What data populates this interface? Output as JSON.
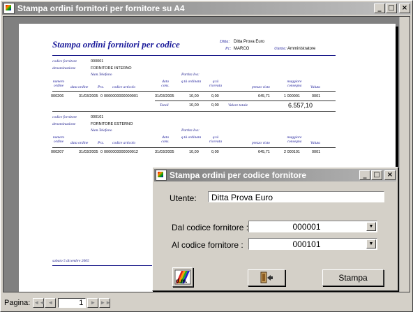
{
  "main_window": {
    "title": "Stampa ordini fornitori per fornitore su A4",
    "min": "_",
    "max": "□",
    "close": "×"
  },
  "report": {
    "title": "Stampa ordini fornitori per codice",
    "header": {
      "ditta_label": "Ditta:",
      "ditta_value": "Ditta Prova Euro",
      "pc_label": "Pc:",
      "pc_value": "MARCO",
      "utente_label": "Utente:",
      "utente_value": "Amministratore"
    },
    "groups": [
      {
        "codice_label": "codice fornitore",
        "codice_value": "000001",
        "denom_label": "denominazione",
        "denom_value": "FORNITORE INTERNO",
        "tel_label": "Num.Telefono",
        "piva_label": "Partita Iva:",
        "columns": [
          "numero ordine",
          "data ordine",
          "Prz.",
          "codice articolo",
          "data cons.",
          "q.tà ordinata",
          "q.tà ricevuta",
          "prezzo visto",
          "maggiore consegna",
          "Valuta"
        ],
        "row": [
          "000206",
          "31/03/2005",
          "0",
          "0000000000000001",
          "31/03/2005",
          "10,00",
          "0,00",
          "645,71",
          "1 000001",
          "0001"
        ],
        "totals_label": "Totali",
        "totals_q1": "10,00",
        "totals_q2": "0,00",
        "totals_value_label": "Valore totale",
        "totals_value": "6.557,10"
      },
      {
        "codice_label": "codice fornitore",
        "codice_value": "000101",
        "denom_label": "denominazione",
        "denom_value": "FORNITORE ESTERNO",
        "tel_label": "Num.Telefono",
        "piva_label": "Partita Iva:",
        "columns": [
          "numero ordine",
          "data ordine",
          "Prz.",
          "codice articolo",
          "data cons.",
          "q.tà ordinata",
          "q.tà ricevuta",
          "prezzo visto",
          "maggiore consegna",
          "Valuta"
        ],
        "row": [
          "000207",
          "31/03/2005",
          "0",
          "0000000000000012",
          "31/03/2005",
          "10,00",
          "0,00",
          "645,71",
          "2 000101",
          "0001"
        ]
      }
    ],
    "footer_date": "sabato 5 dicembre 2005"
  },
  "statusbar": {
    "page_label": "Pagina:",
    "page_value": "1",
    "first": "◄◄",
    "prev": "◄",
    "next": "►",
    "last": "►►"
  },
  "dialog": {
    "title": "Stampa ordini per codice fornitore",
    "min": "_",
    "max": "□",
    "close": "×",
    "utente_label": "Utente:",
    "utente_value": "Ditta Prova Euro",
    "from_label": "Dal codice fornitore :",
    "from_value": "000001",
    "to_label": "Al codice fornitore :",
    "to_value": "000101",
    "dropdown_arrow": "▼",
    "logo_button": "d.m.",
    "print_button": "Stampa"
  }
}
